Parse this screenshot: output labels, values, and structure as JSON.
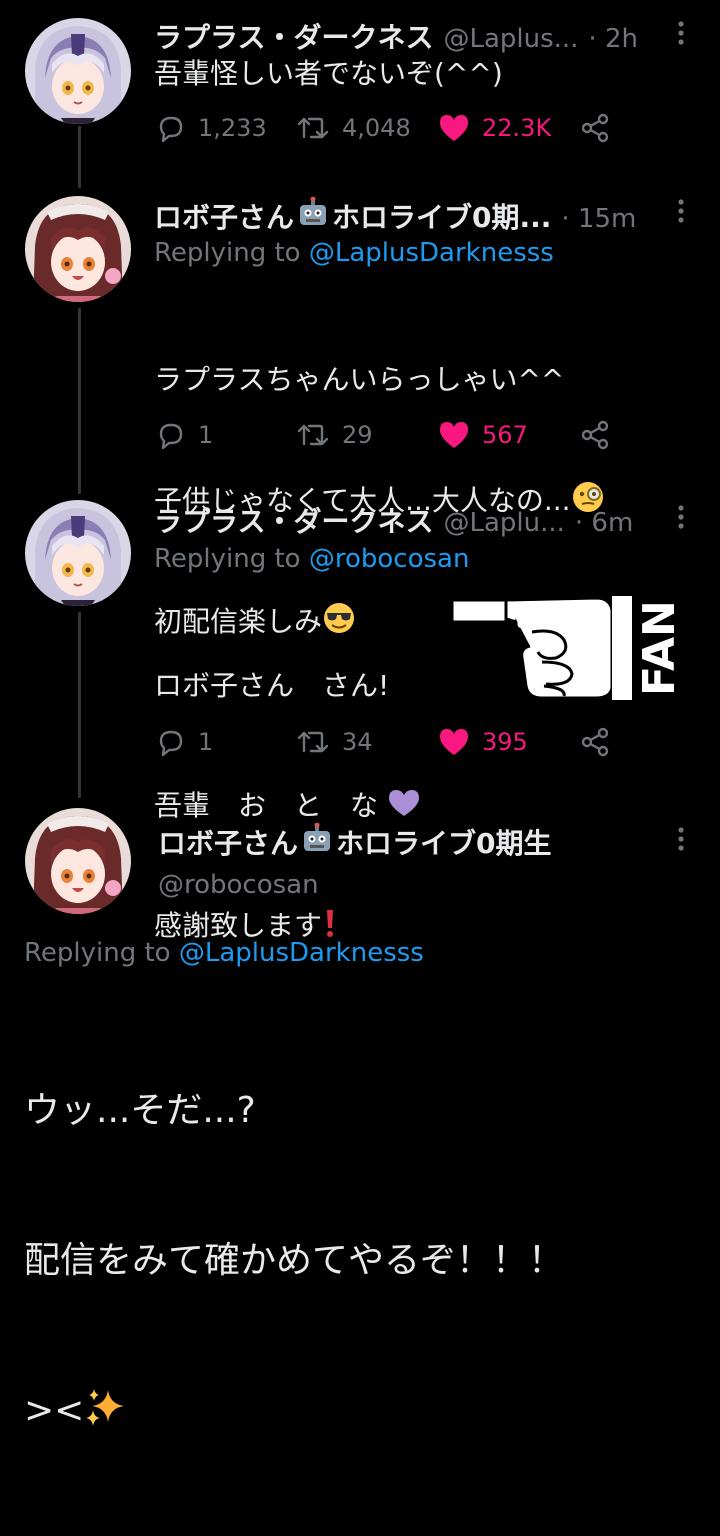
{
  "tweets": [
    {
      "name": "ラプラス・ダークネス",
      "handle": "@Laplus...",
      "time": "· 2h",
      "body": "吾輩怪しい者でないぞ(^^)",
      "replies": "1,233",
      "retweets": "4,048",
      "likes": "22.3K"
    },
    {
      "name": "ロボ子さん",
      "name_suffix": "ホロライブ0期...",
      "time": "· 15m",
      "replying_prefix": "Replying to",
      "replying_to": "@LaplusDarknesss",
      "body_line1": "ラプラスちゃんいらっしゃい^^",
      "body_line2": "子供じゃなくて大人...大人なの...",
      "body_line3": "初配信楽しみ",
      "replies": "1",
      "retweets": "29",
      "likes": "567"
    },
    {
      "name": "ラプラス・ダークネス",
      "handle": "@Laplu...",
      "time": "· 6m",
      "replying_prefix": "Replying to",
      "replying_to": "@robocosan",
      "body_line1": "ロボ子さん　さん!",
      "body_line2": "吾輩　お　と　な",
      "body_line3": "感謝致します",
      "sticker_text": "FAN",
      "replies": "1",
      "retweets": "34",
      "likes": "395"
    }
  ],
  "main_tweet": {
    "name": "ロボ子さん",
    "name_suffix": "ホロライブ0期生",
    "handle": "@robocosan",
    "replying_prefix": "Replying to",
    "replying_to": "@LaplusDarknesss",
    "line1": "ウッ...そだ...?",
    "line2": "配信をみて確かめてやるぞ！！！",
    "line3": "><"
  },
  "colors": {
    "background": "#000000",
    "text": "#e7e9ea",
    "muted": "#71767b",
    "link": "#1d9bf0",
    "like": "#f91880"
  },
  "icons": [
    "reply-icon",
    "retweet-icon",
    "heart-icon",
    "share-icon",
    "more-icon",
    "robot-emoji",
    "monocle-emoji",
    "sunglasses-emoji",
    "purple-heart-emoji",
    "exclamation-emoji",
    "sparkles-emoji",
    "pointing-hand-sticker"
  ]
}
